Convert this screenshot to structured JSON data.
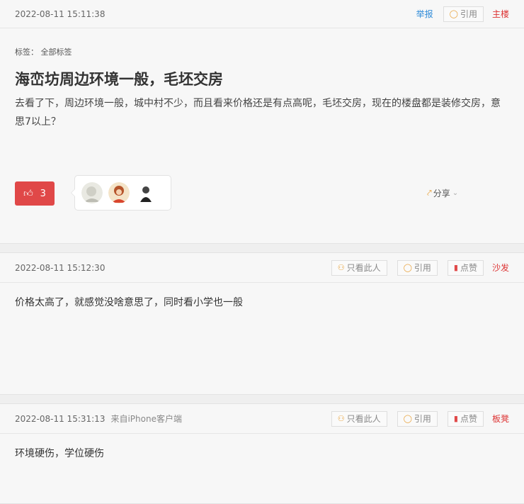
{
  "op": {
    "time": "2022-08-11 15:11:38",
    "report": "举报",
    "quote": "引用",
    "floor": "主楼",
    "tags": "标签： 全部标签",
    "title": "海峦坊周边环境一般，毛坯交房",
    "body": "去看了下，周边环境一般，城中村不少，而且看来价格还是有点高呢，毛坯交房，现在的楼盘都是装修交房，意思7以上？",
    "likes": "3",
    "share": "分享"
  },
  "replies": [
    {
      "time": "2022-08-11 15:12:30",
      "source": "",
      "only_this": "只看此人",
      "quote": "引用",
      "like": "点赞",
      "floor": "沙发",
      "body": "价格太高了，就感觉没啥意思了，同时看小学也一般"
    },
    {
      "time": "2022-08-11 15:31:13",
      "source": "来自iPhone客户端",
      "only_this": "只看此人",
      "quote": "引用",
      "like": "点赞",
      "floor": "板凳",
      "body": "环境硬伤，学位硬伤"
    }
  ],
  "colors": {
    "accent_red": "#e04848",
    "link_blue": "#2f8bd8",
    "icon_orange": "#e8a23b"
  }
}
